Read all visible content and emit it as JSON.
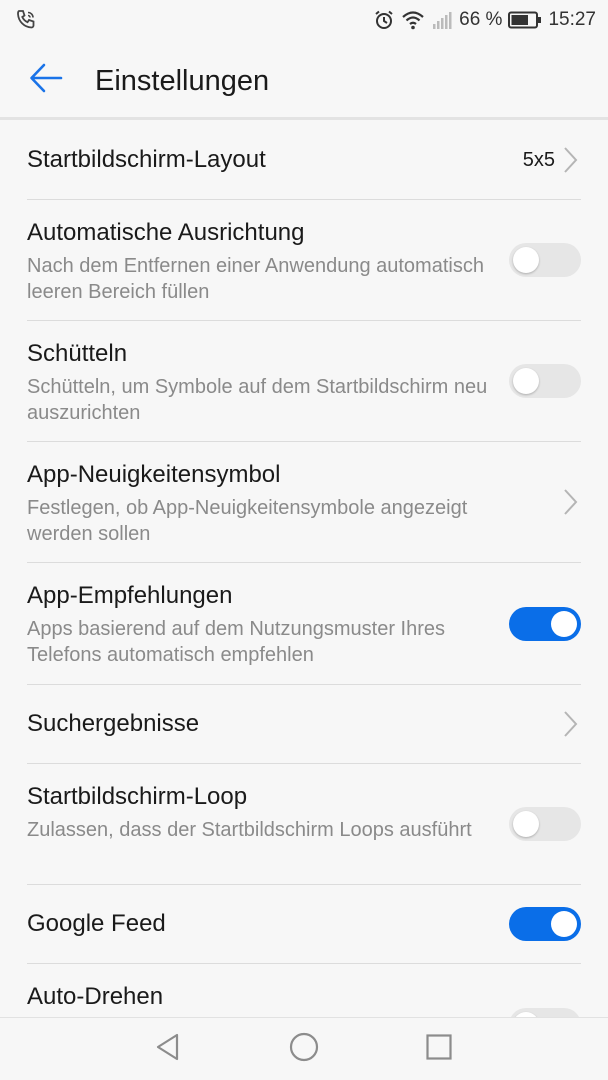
{
  "status_bar": {
    "left_icon": "phone-wifi-call-icon",
    "battery_percent": "66 %",
    "time": "15:27",
    "icons": [
      "alarm-icon",
      "wifi-icon",
      "signal-icon",
      "battery-icon"
    ]
  },
  "header": {
    "back_icon": "arrow-left-icon",
    "title": "Einstellungen",
    "accent_color": "#1a73e8"
  },
  "settings": [
    {
      "title": "Startbildschirm-Layout",
      "summary": "",
      "value": "5x5",
      "control": "chevron"
    },
    {
      "title": "Automatische Ausrichtung",
      "summary": "Nach dem Entfernen einer Anwendung automatisch leeren Bereich füllen",
      "control": "toggle",
      "on": false
    },
    {
      "title": "Schütteln",
      "summary": "Schütteln, um Symbole auf dem Startbildschirm neu auszurichten",
      "control": "toggle",
      "on": false
    },
    {
      "title": "App-Neuigkeitensymbol",
      "summary": "Festlegen, ob App-Neuigkeitensymbole angezeigt werden sollen",
      "control": "chevron"
    },
    {
      "title": "App-Empfehlungen",
      "summary": "Apps basierend auf dem Nutzungsmuster Ihres Telefons automatisch empfehlen",
      "control": "toggle",
      "on": true
    },
    {
      "title": "Suchergebnisse",
      "summary": "",
      "control": "chevron"
    },
    {
      "title": "Startbildschirm-Loop",
      "summary": "Zulassen, dass der Startbildschirm Loops ausführt",
      "control": "toggle",
      "on": false
    },
    {
      "title": "Google Feed",
      "summary": "",
      "control": "toggle",
      "on": true
    },
    {
      "title": "Auto-Drehen",
      "summary": "",
      "control": "toggle",
      "on": false
    }
  ],
  "toggle_colors": {
    "on": "#0a6ee8",
    "off": "#e6e6e6"
  },
  "nav_bar": {
    "icons": [
      "nav-back-icon",
      "nav-home-icon",
      "nav-recents-icon"
    ]
  }
}
